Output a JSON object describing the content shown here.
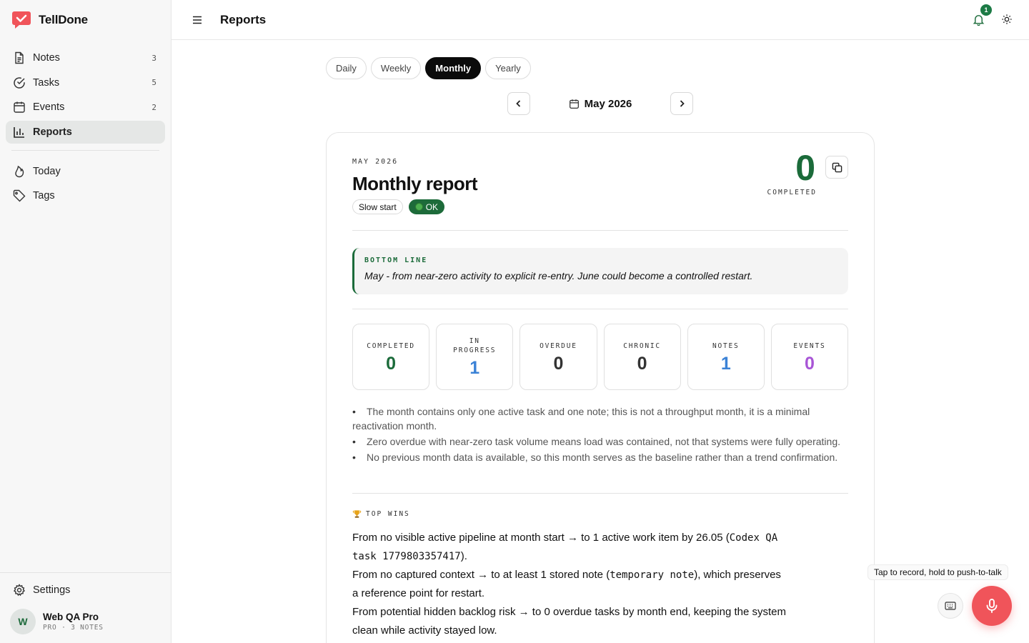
{
  "app": {
    "name": "TellDone"
  },
  "sidebar": {
    "items": [
      {
        "label": "Notes",
        "count": "3"
      },
      {
        "label": "Tasks",
        "count": "5"
      },
      {
        "label": "Events",
        "count": "2"
      },
      {
        "label": "Reports",
        "count": ""
      }
    ],
    "secondary": [
      {
        "label": "Today"
      },
      {
        "label": "Tags"
      }
    ],
    "settings_label": "Settings",
    "user": {
      "initial": "W",
      "name": "Web QA Pro",
      "sub": "PRO · 3 NOTES"
    }
  },
  "header": {
    "title": "Reports",
    "notification_count": "1"
  },
  "period": {
    "tabs": [
      "Daily",
      "Weekly",
      "Monthly",
      "Yearly"
    ],
    "active_tab": "Monthly",
    "label": "May 2026"
  },
  "report": {
    "eyebrow": "MAY 2026",
    "title": "Monthly report",
    "chips": {
      "mood": "Slow start",
      "status": "OK"
    },
    "completed_count": "0",
    "completed_label": "COMPLETED",
    "bottom_line": {
      "heading": "BOTTOM LINE",
      "text": "May - from near-zero activity to explicit re-entry. June could become a controlled restart."
    },
    "stats": [
      {
        "label": "COMPLETED",
        "value": "0",
        "color": "#1b6b3a"
      },
      {
        "label": "IN PROGRESS",
        "value": "1",
        "color": "#3b82d6"
      },
      {
        "label": "OVERDUE",
        "value": "0",
        "color": "#333333"
      },
      {
        "label": "CHRONIC",
        "value": "0",
        "color": "#333333"
      },
      {
        "label": "NOTES",
        "value": "1",
        "color": "#3b82d6"
      },
      {
        "label": "EVENTS",
        "value": "0",
        "color": "#a855d6"
      }
    ],
    "bullets": [
      "The month contains only one active task and one note; this is not a throughput month, it is a minimal reactivation month.",
      "Zero overdue with near-zero task volume means load was contained, not that systems were fully operating.",
      "No previous month data is available, so this month serves as the baseline rather than a trend confirmation."
    ],
    "top_wins": {
      "heading": "TOP WINS",
      "items": [
        {
          "before": "From no visible active pipeline at month start → to 1 active work item by 26.05 (",
          "code": "Codex QA task 1779803357417",
          "after": ")."
        },
        {
          "before": "From no captured context → to at least 1 stored note (",
          "code": "temporary note",
          "after": "), which preserves a reference point for restart."
        },
        {
          "before": "From potential hidden backlog risk → to 0 overdue tasks by month end, keeping the system clean while activity stayed low.",
          "code": "",
          "after": ""
        }
      ]
    }
  },
  "voice": {
    "tooltip": "Tap to record, hold to push-to-talk"
  },
  "colors": {
    "accent": "#1b6b3a",
    "mic": "#f0545a",
    "brand": "#f0545a"
  }
}
